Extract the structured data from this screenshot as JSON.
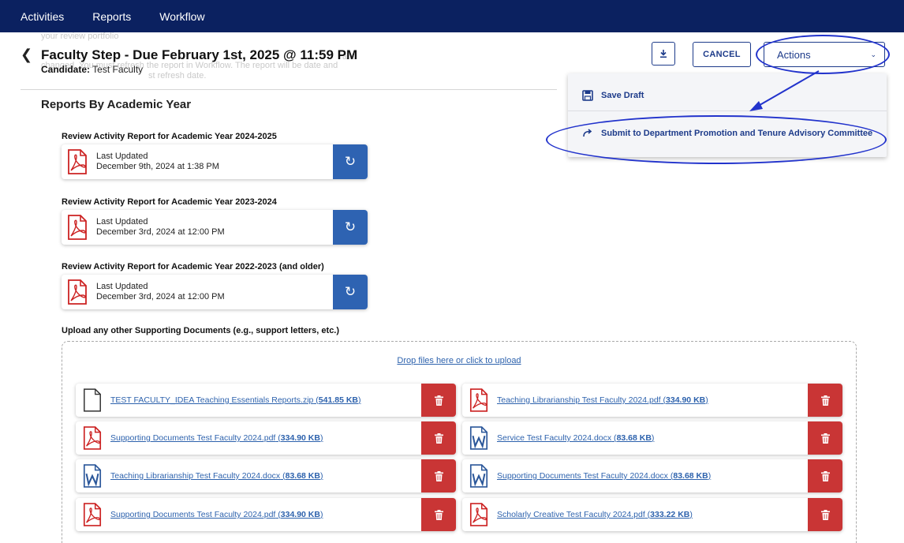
{
  "nav": {
    "items": [
      "Activities",
      "Reports",
      "Workflow"
    ]
  },
  "ghost": {
    "line1": "your review portfolio",
    "line2": "a is",
    "line3": "changed. You must refresh the report in Workflow. The report will be date and",
    "line4": "st refresh date."
  },
  "header": {
    "title": "Faculty Step - Due February 1st, 2025 @ 11:59 PM",
    "candidate_label": "Candidate:",
    "candidate_value": "Test Faculty"
  },
  "toolbar": {
    "download_icon": "download-icon",
    "cancel_label": "CANCEL",
    "actions_label": "Actions"
  },
  "actions_menu": {
    "items": [
      {
        "label": "Save Draft",
        "icon": "save-icon"
      },
      {
        "label": "Submit to Department Promotion and Tenure Advisory Committee",
        "icon": "share-arrow-icon"
      }
    ]
  },
  "annotation_color": "#2233cc",
  "reports": {
    "title": "Reports By Academic Year",
    "items": [
      {
        "heading": "Review Activity Report for Academic Year 2024-2025",
        "updated_label": "Last Updated",
        "updated_value": "December 9th, 2024 at 1:38 PM"
      },
      {
        "heading": "Review Activity Report for Academic Year 2023-2024",
        "updated_label": "Last Updated",
        "updated_value": "December 3rd, 2024 at 12:00 PM"
      },
      {
        "heading": "Review Activity Report for Academic Year 2022-2023 (and older)",
        "updated_label": "Last Updated",
        "updated_value": "December 3rd, 2024 at 12:00 PM"
      }
    ]
  },
  "upload": {
    "label": "Upload any other Supporting Documents (e.g., support letters, etc.)",
    "drop_text": "Drop files here or click to upload"
  },
  "files": [
    {
      "name": "TEST FACULTY_IDEA Teaching Essentials Reports.zip",
      "size": "541.85 KB",
      "type": "zip"
    },
    {
      "name": "Teaching Librarianship Test Faculty 2024.pdf",
      "size": "334.90 KB",
      "type": "pdf"
    },
    {
      "name": "Supporting Documents Test Faculty 2024.pdf",
      "size": "334.90 KB",
      "type": "pdf"
    },
    {
      "name": "Service Test Faculty 2024.docx",
      "size": "83.68 KB",
      "type": "docx"
    },
    {
      "name": "Teaching Librarianship Test Faculty 2024.docx",
      "size": "83.68 KB",
      "type": "docx"
    },
    {
      "name": "Supporting Documents Test Faculty 2024.docx",
      "size": "83.68 KB",
      "type": "docx"
    },
    {
      "name": "Supporting Documents Test Faculty 2024.pdf",
      "size": "334.90 KB",
      "type": "pdf"
    },
    {
      "name": "Scholarly Creative Test Faculty 2024.pdf",
      "size": "333.22 KB",
      "type": "pdf"
    }
  ],
  "colors": {
    "nav_bg": "#0b2160",
    "primary": "#1d3b8a",
    "refresh": "#2e63b2",
    "delete": "#c93535",
    "link": "#2d62ad",
    "pdf_red": "#cc2222",
    "word_blue": "#2b579a"
  }
}
